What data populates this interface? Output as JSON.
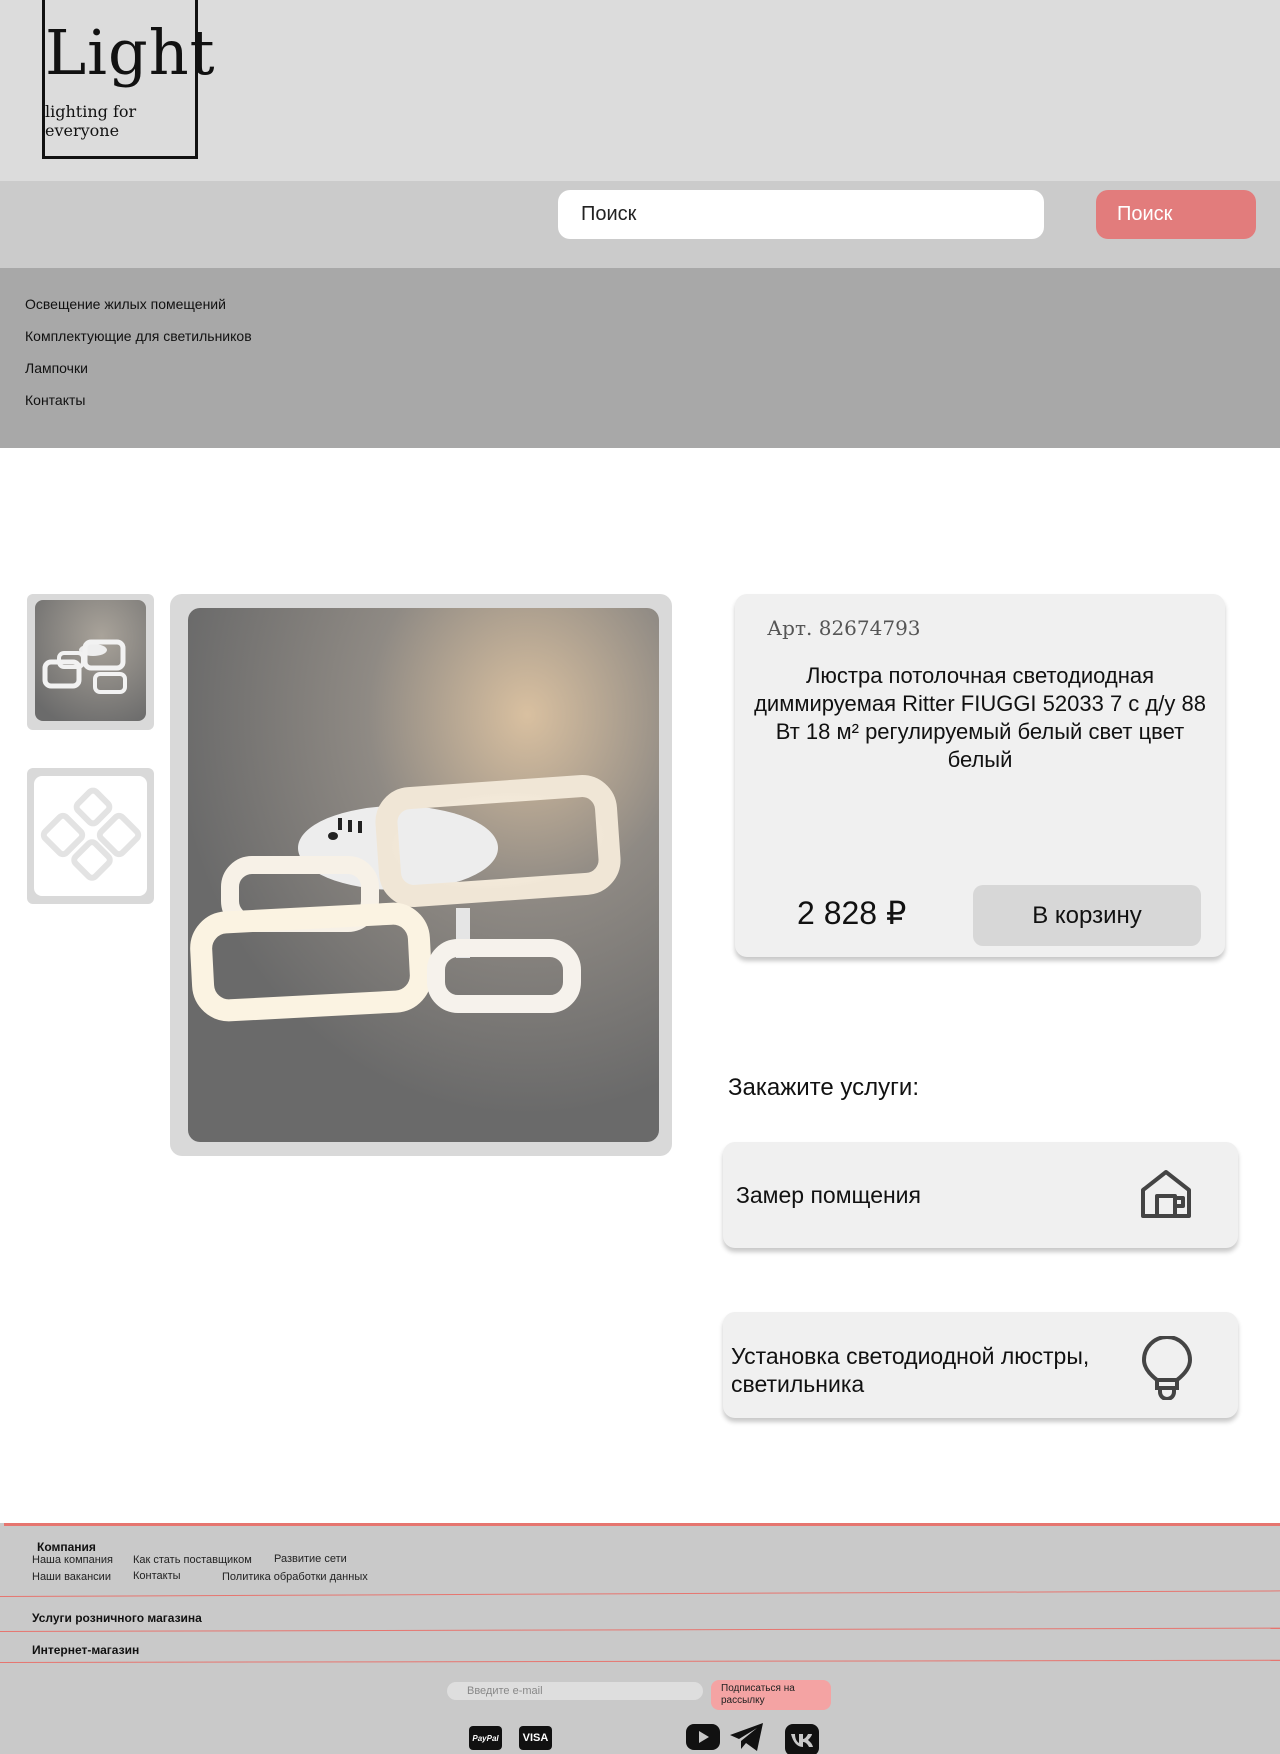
{
  "logo": {
    "wordmark": "Light",
    "tagline": "lighting for everyone"
  },
  "search": {
    "placeholder": "Поиск",
    "button_label": "Поиск"
  },
  "categories": [
    {
      "label": "Освещение жилых помещений"
    },
    {
      "label": "Комплектующие для светильников"
    },
    {
      "label": "Лампочки"
    },
    {
      "label": "Контакты"
    }
  ],
  "product": {
    "article": "Арт. 82674793",
    "title": "Люстра потолочная светодиодная диммируемая Ritter FIUGGI 52033 7 с д/у 88 Вт 18 м² регулируемый белый свет цвет белый",
    "price": "2 828 ₽",
    "cart_button": "В корзину",
    "thumbnail_count": 2
  },
  "services": {
    "title": "Закажите услуги:",
    "items": [
      {
        "label": "Замер помщения",
        "icon": "house-icon"
      },
      {
        "label": "Установка светодиодной люстры, светильника",
        "icon": "lightbulb-icon"
      }
    ]
  },
  "footer": {
    "company_heading": "Компания",
    "company_links": [
      "Наша компания",
      "Как стать поставщиком",
      "Развитие сети",
      "Наши вакансии",
      "Контакты",
      "Политика обработки данных"
    ],
    "retail_heading": "Услуги розничного магазина",
    "shop_heading": "Интернет-магазин",
    "email_placeholder": "Введите e-mail",
    "subscribe_button": "Подписаться на рассылку",
    "payments": [
      "PayPal",
      "VISA"
    ],
    "socials": [
      "youtube-icon",
      "telegram-icon",
      "vk-icon"
    ]
  },
  "colors": {
    "accent": "#e27c7c",
    "header_bg": "#dcdcdc",
    "nav_bg": "#a8a8a8",
    "footer_line": "#e6756f"
  }
}
